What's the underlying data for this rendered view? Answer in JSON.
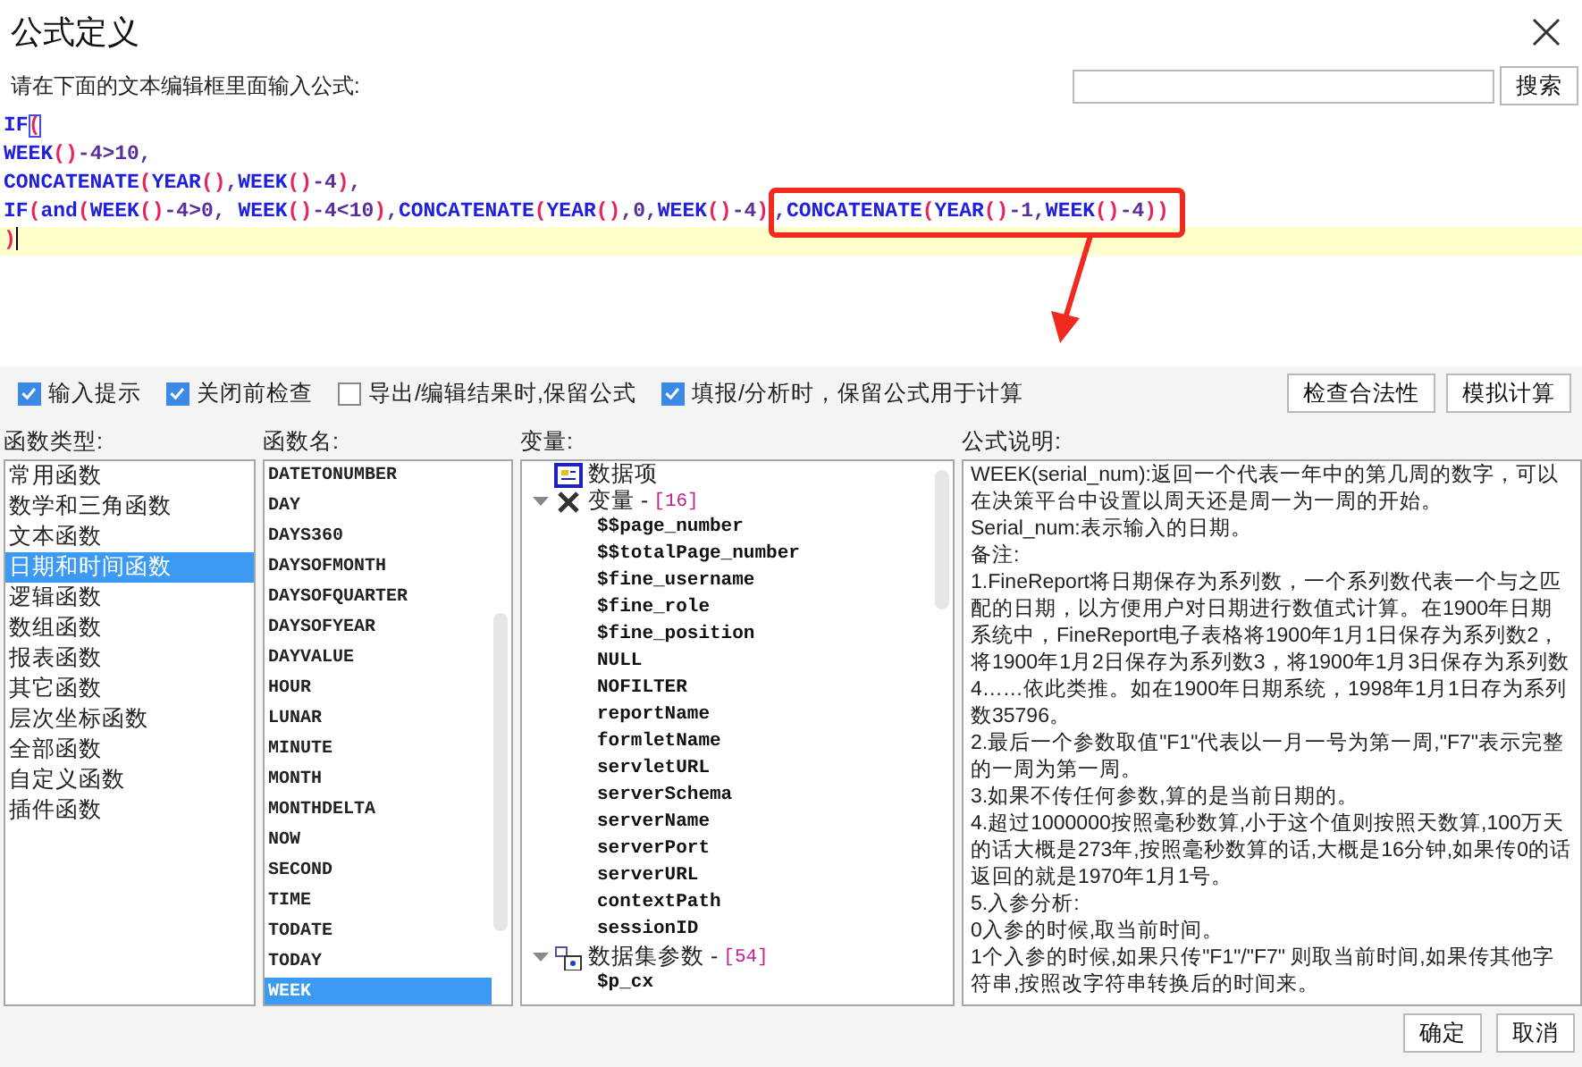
{
  "window": {
    "title": "公式定义"
  },
  "prompt": {
    "label": "请在下面的文本编辑框里面输入公式:",
    "search_button": "搜索"
  },
  "editor": {
    "lines": [
      {
        "current": false,
        "cursor": false,
        "segments": [
          {
            "boxed": false,
            "tokens": [
              {
                "kind": "fn",
                "text": "IF"
              },
              {
                "kind": "match",
                "text": "("
              }
            ]
          }
        ]
      },
      {
        "current": false,
        "cursor": false,
        "segments": [
          {
            "boxed": false,
            "tokens": [
              {
                "kind": "fn",
                "text": "WEEK"
              },
              {
                "kind": "paren",
                "text": "()"
              },
              {
                "kind": "text",
                "text": "-4>10,"
              }
            ]
          }
        ]
      },
      {
        "current": false,
        "cursor": false,
        "segments": [
          {
            "boxed": false,
            "tokens": [
              {
                "kind": "fn",
                "text": "CONCATENATE"
              },
              {
                "kind": "paren",
                "text": "("
              },
              {
                "kind": "fn",
                "text": "YEAR"
              },
              {
                "kind": "paren",
                "text": "()"
              },
              {
                "kind": "text",
                "text": ","
              },
              {
                "kind": "fn",
                "text": "WEEK"
              },
              {
                "kind": "paren",
                "text": "()"
              },
              {
                "kind": "text",
                "text": "-4"
              },
              {
                "kind": "paren",
                "text": ")"
              },
              {
                "kind": "text",
                "text": ","
              }
            ]
          }
        ]
      },
      {
        "current": false,
        "cursor": false,
        "segments": [
          {
            "boxed": false,
            "tokens": [
              {
                "kind": "fn",
                "text": "IF"
              },
              {
                "kind": "paren",
                "text": "("
              },
              {
                "kind": "fn",
                "text": "and"
              },
              {
                "kind": "paren",
                "text": "("
              },
              {
                "kind": "fn",
                "text": "WEEK"
              },
              {
                "kind": "paren",
                "text": "()"
              },
              {
                "kind": "text",
                "text": "-4>0, "
              },
              {
                "kind": "fn",
                "text": "WEEK"
              },
              {
                "kind": "paren",
                "text": "()"
              },
              {
                "kind": "text",
                "text": "-4<10"
              },
              {
                "kind": "paren",
                "text": ")"
              },
              {
                "kind": "text",
                "text": ","
              },
              {
                "kind": "fn",
                "text": "CONCATENATE"
              },
              {
                "kind": "paren",
                "text": "("
              },
              {
                "kind": "fn",
                "text": "YEAR"
              },
              {
                "kind": "paren",
                "text": "()"
              },
              {
                "kind": "text",
                "text": ",0,"
              },
              {
                "kind": "fn",
                "text": "WEEK"
              },
              {
                "kind": "paren",
                "text": "()"
              },
              {
                "kind": "text",
                "text": "-4"
              },
              {
                "kind": "paren",
                "text": ")"
              }
            ]
          },
          {
            "boxed": true,
            "tokens": [
              {
                "kind": "text",
                "text": ","
              },
              {
                "kind": "fn",
                "text": "CONCATENATE"
              },
              {
                "kind": "paren",
                "text": "("
              },
              {
                "kind": "fn",
                "text": "YEAR"
              },
              {
                "kind": "paren",
                "text": "()"
              },
              {
                "kind": "text",
                "text": "-1,"
              },
              {
                "kind": "fn",
                "text": "WEEK"
              },
              {
                "kind": "paren",
                "text": "()"
              },
              {
                "kind": "text",
                "text": "-4"
              },
              {
                "kind": "paren",
                "text": "))"
              }
            ]
          }
        ]
      },
      {
        "current": true,
        "cursor": true,
        "segments": [
          {
            "boxed": false,
            "tokens": [
              {
                "kind": "paren",
                "text": ")"
              }
            ]
          }
        ]
      }
    ]
  },
  "options": [
    {
      "label": "输入提示",
      "checked": true
    },
    {
      "label": "关闭前检查",
      "checked": true
    },
    {
      "label": "导出/编辑结果时,保留公式",
      "checked": false
    },
    {
      "label": "填报/分析时，保留公式用于计算",
      "checked": true
    }
  ],
  "option_buttons": [
    "检查合法性",
    "模拟计算"
  ],
  "function_types": {
    "header": "函数类型:",
    "items": [
      {
        "label": "常用函数",
        "selected": false
      },
      {
        "label": "数学和三角函数",
        "selected": false
      },
      {
        "label": "文本函数",
        "selected": false
      },
      {
        "label": "日期和时间函数",
        "selected": true
      },
      {
        "label": "逻辑函数",
        "selected": false
      },
      {
        "label": "数组函数",
        "selected": false
      },
      {
        "label": "报表函数",
        "selected": false
      },
      {
        "label": "其它函数",
        "selected": false
      },
      {
        "label": "层次坐标函数",
        "selected": false
      },
      {
        "label": "全部函数",
        "selected": false
      },
      {
        "label": "自定义函数",
        "selected": false
      },
      {
        "label": "插件函数",
        "selected": false
      }
    ]
  },
  "function_names": {
    "header": "函数名:",
    "items": [
      {
        "label": "DATETONUMBER",
        "selected": false
      },
      {
        "label": "DAY",
        "selected": false
      },
      {
        "label": "DAYS360",
        "selected": false
      },
      {
        "label": "DAYSOFMONTH",
        "selected": false
      },
      {
        "label": "DAYSOFQUARTER",
        "selected": false
      },
      {
        "label": "DAYSOFYEAR",
        "selected": false
      },
      {
        "label": "DAYVALUE",
        "selected": false
      },
      {
        "label": "HOUR",
        "selected": false
      },
      {
        "label": "LUNAR",
        "selected": false
      },
      {
        "label": "MINUTE",
        "selected": false
      },
      {
        "label": "MONTH",
        "selected": false
      },
      {
        "label": "MONTHDELTA",
        "selected": false
      },
      {
        "label": "NOW",
        "selected": false
      },
      {
        "label": "SECOND",
        "selected": false
      },
      {
        "label": "TIME",
        "selected": false
      },
      {
        "label": "TODATE",
        "selected": false
      },
      {
        "label": "TODAY",
        "selected": false
      },
      {
        "label": "WEEK",
        "selected": true
      }
    ]
  },
  "variables": {
    "header": "变量:",
    "tree": [
      {
        "kind": "item",
        "label": "数据项"
      },
      {
        "kind": "variables",
        "label": "变量 -",
        "count": "[16]",
        "expanded": true,
        "children": [
          {
            "label": "$$page_number"
          },
          {
            "label": "$$totalPage_number"
          },
          {
            "label": "$fine_username"
          },
          {
            "label": "$fine_role"
          },
          {
            "label": "$fine_position"
          },
          {
            "label": "NULL"
          },
          {
            "label": "NOFILTER"
          },
          {
            "label": "reportName"
          },
          {
            "label": "formletName"
          },
          {
            "label": "servletURL"
          },
          {
            "label": "serverSchema"
          },
          {
            "label": "serverName"
          },
          {
            "label": "serverPort"
          },
          {
            "label": "serverURL"
          },
          {
            "label": "contextPath"
          },
          {
            "label": "sessionID"
          }
        ]
      },
      {
        "kind": "params",
        "label": "数据集参数 -",
        "count": "[54]",
        "expanded": true,
        "children": [
          {
            "label": "$p_cx"
          }
        ]
      }
    ]
  },
  "description": {
    "header": "公式说明:",
    "paragraphs": [
      "WEEK(serial_num):返回一个代表一年中的第几周的数字，可以在决策平台中设置以周天还是周一为一周的开始。",
      "Serial_num:表示输入的日期。",
      "备注:",
      "1.FineReport将日期保存为系列数，一个系列数代表一个与之匹配的日期，以方便用户对日期进行数值式计算。在1900年日期系统中，FineReport电子表格将1900年1月1日保存为系列数2，",
      "将1900年1月2日保存为系列数3，将1900年1月3日保存为系列数4……依此类推。如在1900年日期系统，1998年1月1日存为系列数35796。",
      "2.最后一个参数取值\"F1\"代表以一月一号为第一周,\"F7\"表示完整的一周为第一周。",
      "3.如果不传任何参数,算的是当前日期的。",
      "4.超过1000000按照毫秒数算,小于这个值则按照天数算,100万天的话大概是273年,按照毫秒数算的话,大概是16分钟,如果传0的话返回的就是1970年1月1号。",
      "5.入参分析:",
      "0入参的时候,取当前时间。",
      "1个入参的时候,如果只传\"F1\"/\"F7\" 则取当前时间,如果传其他字符串,按照改字符串转换后的时间来。"
    ]
  },
  "buttons": [
    "确定",
    "取消"
  ]
}
